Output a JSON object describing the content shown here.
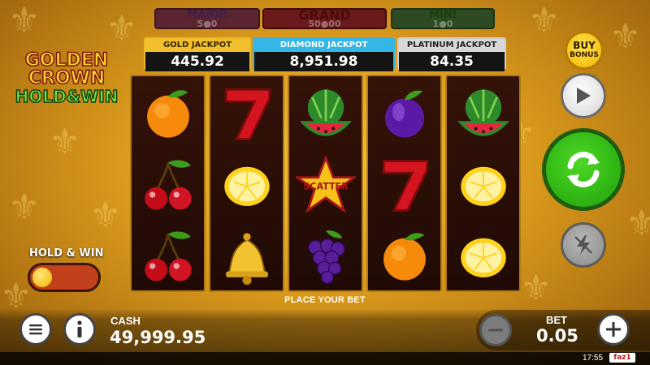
{
  "locked_jackpots": [
    {
      "name": "MAJOR",
      "value": "5●0"
    },
    {
      "name": "GRAND",
      "value": "50●00"
    },
    {
      "name": "MINI",
      "value": "1●0"
    }
  ],
  "jackpots": {
    "gold": {
      "title": "GOLD JACKPOT",
      "value": "445.92"
    },
    "diamond": {
      "title": "DIAMOND JACKPOT",
      "value": "8,951.98"
    },
    "platinum": {
      "title": "PLATINUM JACKPOT",
      "value": "84.35"
    }
  },
  "logo": {
    "line1": "GOLDEN",
    "line2": "CROWN",
    "line3": "HOLD&WIN"
  },
  "reels": [
    [
      "orange",
      "cherries",
      "cherries"
    ],
    [
      "seven",
      "lemon",
      "bell"
    ],
    [
      "watermelon",
      "scatter",
      "grapes"
    ],
    [
      "plum",
      "seven",
      "orange"
    ],
    [
      "watermelon",
      "lemon",
      "lemon"
    ]
  ],
  "scatter_label": "SCATTER",
  "place_bet": "PLACE YOUR BET",
  "hold_win": {
    "label": "HOLD & WIN",
    "enabled": false
  },
  "buy_bonus": {
    "line1": "BUY",
    "line2": "BONUS"
  },
  "cash": {
    "label": "CASH",
    "value": "49,999.95"
  },
  "bet": {
    "label": "BET",
    "value": "0.05"
  },
  "status": {
    "time": "17:55",
    "brand": "faz1"
  },
  "colors": {
    "spin": "#2fb81a",
    "gold": "#f1c02c",
    "diamond": "#35b6e8",
    "platinum": "#d8d8d8"
  }
}
